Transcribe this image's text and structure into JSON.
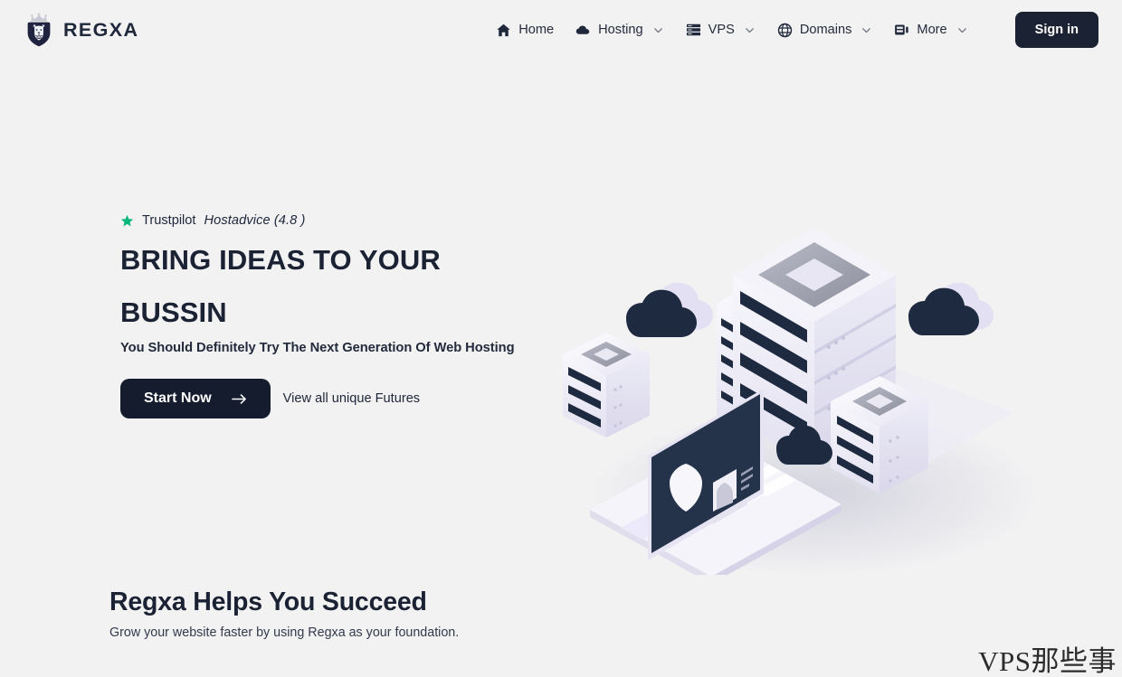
{
  "theme": {
    "page_bg": "#f2f2f3",
    "ink": "#1b2233",
    "accent_dark": "#141c2e",
    "trustpilot_green": "#00b67a",
    "illustration_light": "#eceaf6",
    "illustration_dark": "#1e2a40"
  },
  "header": {
    "brand": {
      "name": "REGXA",
      "icon": "lion-crown-logo"
    },
    "nav": [
      {
        "label": "Home",
        "icon": "home-icon",
        "has_caret": false
      },
      {
        "label": "Hosting",
        "icon": "cloud-icon",
        "has_caret": true
      },
      {
        "label": "VPS",
        "icon": "server-icon",
        "has_caret": true
      },
      {
        "label": "Domains",
        "icon": "globe-icon",
        "has_caret": true
      },
      {
        "label": "More",
        "icon": "rack-icon",
        "has_caret": true
      }
    ],
    "signin_label": "Sign in"
  },
  "hero": {
    "rating": {
      "star_icon": "star-icon",
      "brand": "Trustpilot",
      "alt": "Hostadvice (4.8 )"
    },
    "title_line1": "BRING IDEAS TO YOUR",
    "title_line2": "BUSSIN",
    "subtitle": "You Should Definitely Try The Next Generation Of Web Hosting",
    "cta_label": "Start Now",
    "cta_icon": "arrow-right-icon",
    "secondary_link": "View all unique Futures",
    "illustration": "isometric-servers-laptop-clouds"
  },
  "succeed": {
    "title": "Regxa Helps You Succeed",
    "subtitle": "Grow your website faster by using Regxa as your foundation."
  },
  "watermark": {
    "text": "VPS那些事"
  }
}
